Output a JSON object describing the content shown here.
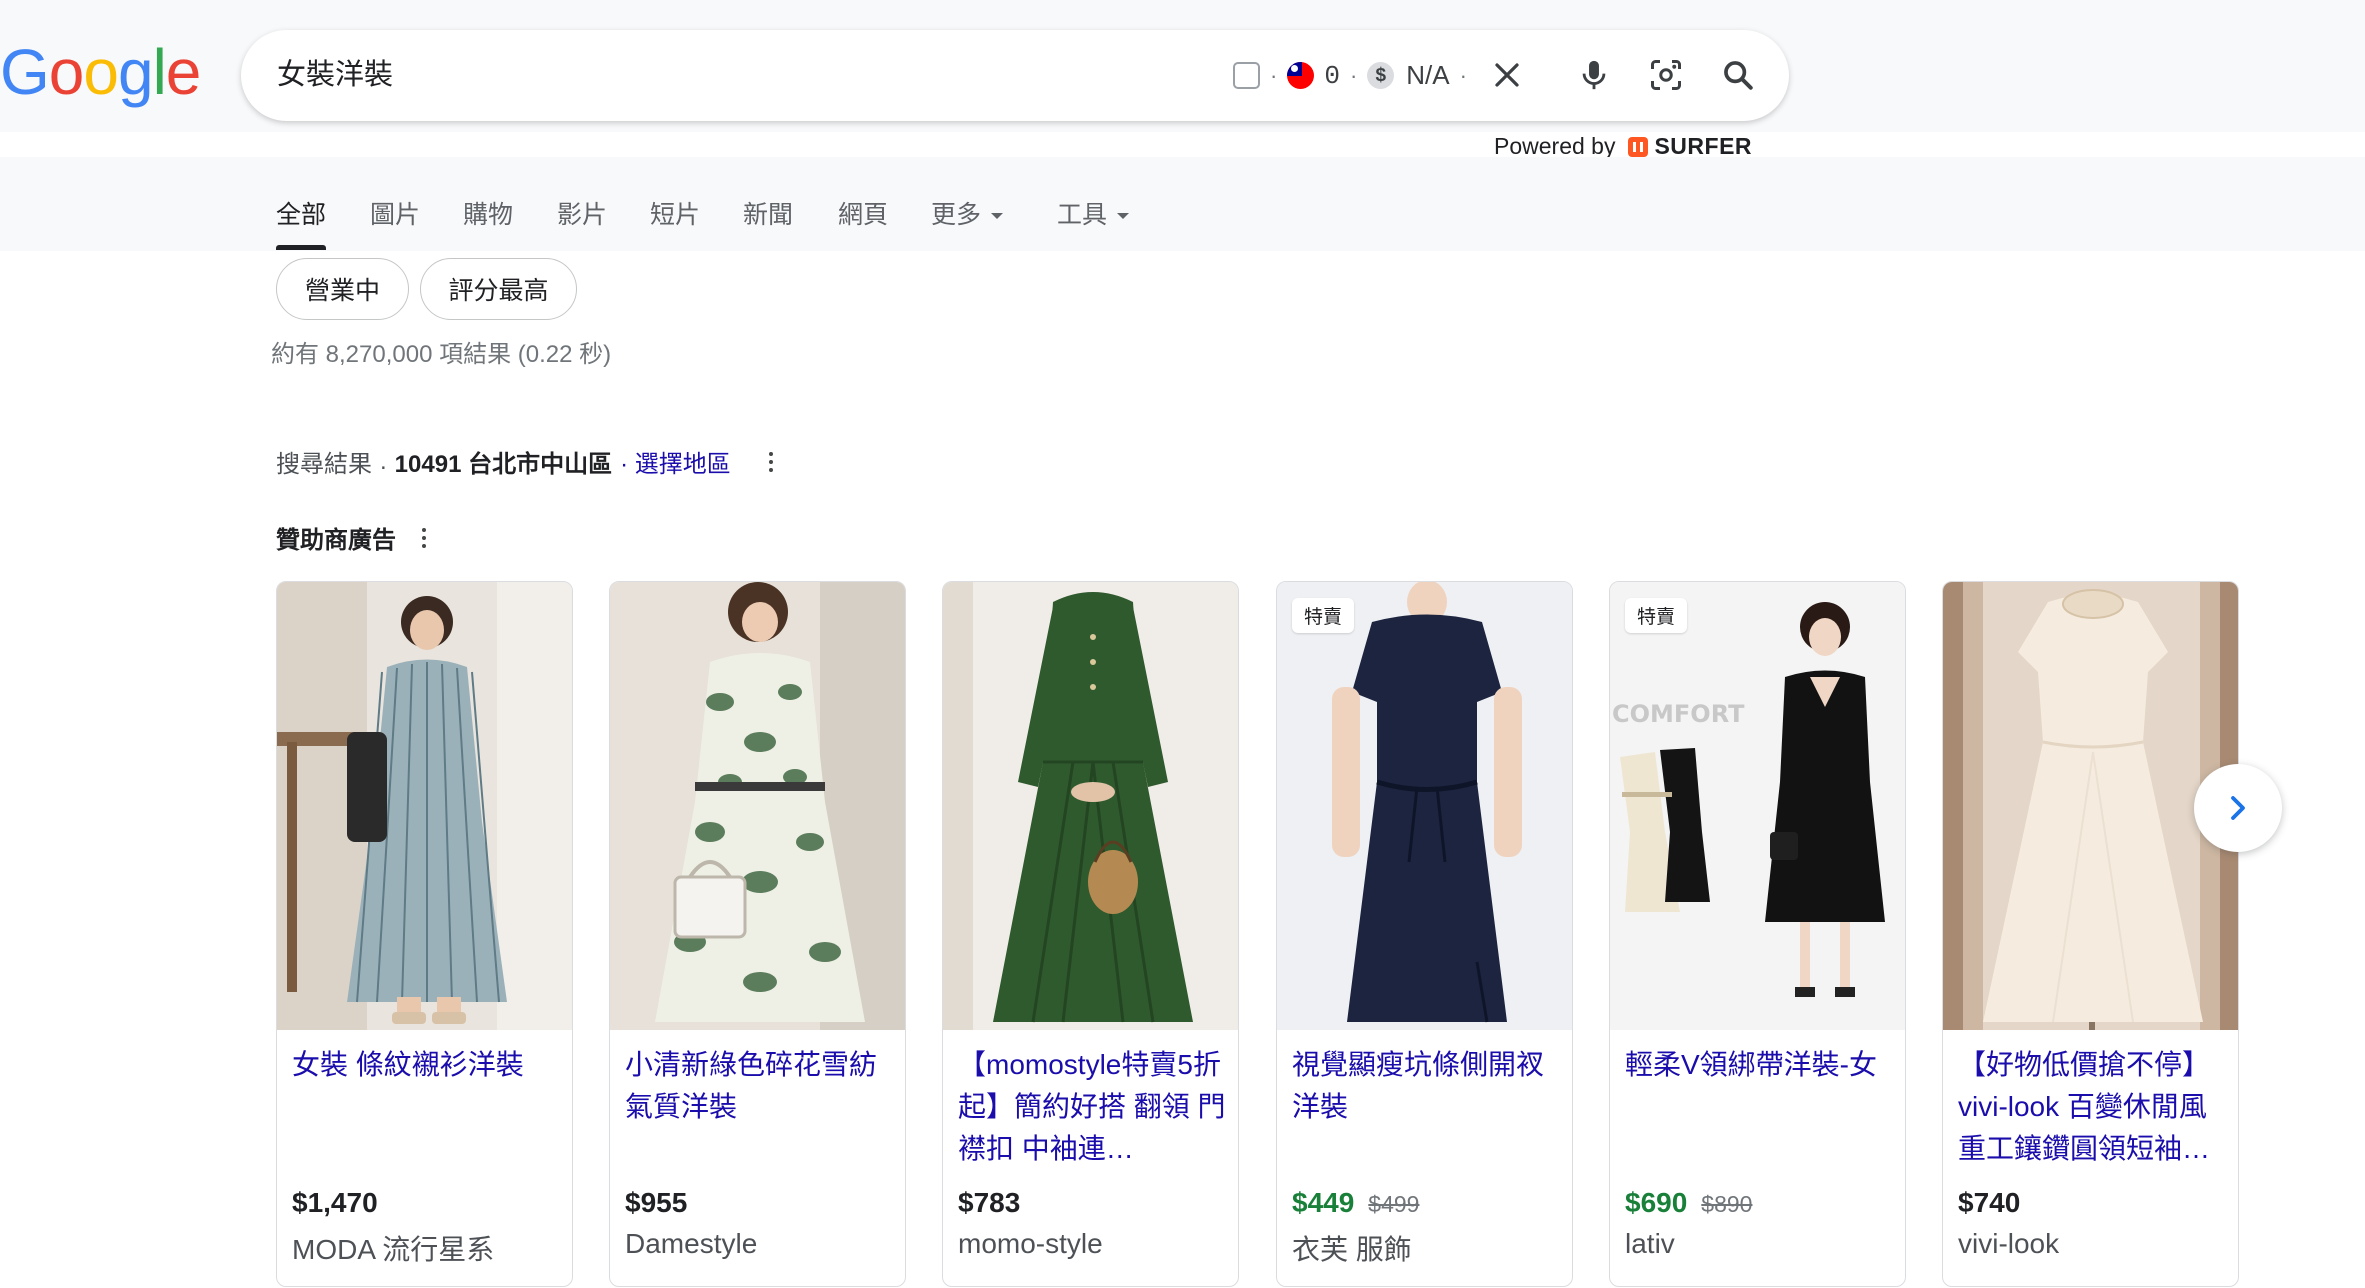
{
  "logo": "Google",
  "search": {
    "query": "女裝洋裝",
    "ext_count": "0",
    "ext_value": "N/A"
  },
  "powered_by": {
    "label": "Powered by",
    "brand": "SURFER"
  },
  "tabs": [
    {
      "label": "全部",
      "active": true
    },
    {
      "label": "圖片"
    },
    {
      "label": "購物"
    },
    {
      "label": "影片"
    },
    {
      "label": "短片"
    },
    {
      "label": "新聞"
    },
    {
      "label": "網頁"
    },
    {
      "label": "更多"
    },
    {
      "label": "工具"
    }
  ],
  "chips": [
    "營業中",
    "評分最高"
  ],
  "result_stats": "約有 8,270,000 項結果 (0.22 秒)",
  "location": {
    "prefix": "搜尋結果",
    "sep": ".",
    "place": "10491 台北市中山區",
    "link": "· 選擇地區"
  },
  "sponsored_label": "贊助商廣告",
  "products": [
    {
      "title": "女裝 條紋襯衫洋裝",
      "price": "$1,470",
      "old_price": "",
      "store": "MODA 流行星系",
      "badge": ""
    },
    {
      "title": "小清新綠色碎花雪紡氣質洋裝",
      "price": "$955",
      "old_price": "",
      "store": "Damestyle",
      "badge": ""
    },
    {
      "title": "【momostyle特賣5折起】簡約好搭 翻領 門襟扣 中袖連…",
      "price": "$783",
      "old_price": "",
      "store": "momo-style",
      "badge": ""
    },
    {
      "title": "視覺顯瘦坑條側開衩洋裝",
      "price": "$449",
      "old_price": "$499",
      "store": "衣芙 服飾",
      "badge": "特賣"
    },
    {
      "title": "輕柔V領綁帶洋裝-女",
      "price": "$690",
      "old_price": "$890",
      "store": "lativ",
      "badge": "特賣"
    },
    {
      "title": "【好物低價搶不停】vivi-look 百變休閒風 重工鑲鑽圓領短袖…",
      "price": "$740",
      "old_price": "",
      "store": "vivi-look",
      "badge": ""
    }
  ],
  "product_images": [
    "striped-shirt-dress-photo",
    "green-floral-dress-photo",
    "green-linen-dress-photo",
    "navy-drawstring-dress-photo",
    "v-neck-tie-dress-photo",
    "white-round-neck-dress-photo"
  ],
  "colors": {
    "link": "#1a0dab",
    "sale_price": "#188038",
    "tab_bg": "#f8f9fa"
  }
}
